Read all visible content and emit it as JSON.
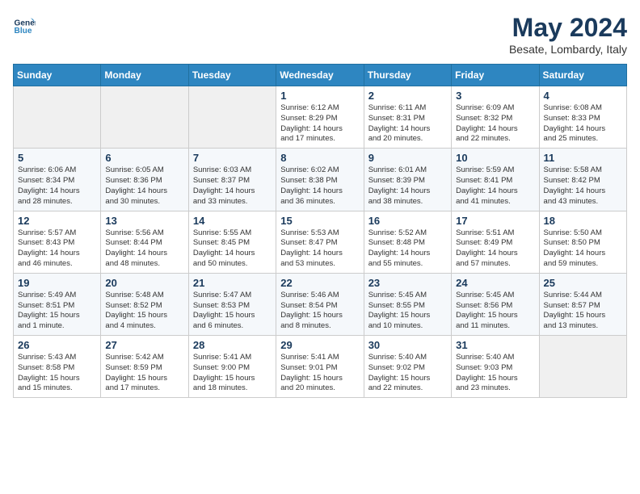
{
  "header": {
    "logo_line1": "General",
    "logo_line2": "Blue",
    "month": "May 2024",
    "location": "Besate, Lombardy, Italy"
  },
  "days_of_week": [
    "Sunday",
    "Monday",
    "Tuesday",
    "Wednesday",
    "Thursday",
    "Friday",
    "Saturday"
  ],
  "weeks": [
    [
      {
        "day": "",
        "info": ""
      },
      {
        "day": "",
        "info": ""
      },
      {
        "day": "",
        "info": ""
      },
      {
        "day": "1",
        "info": "Sunrise: 6:12 AM\nSunset: 8:29 PM\nDaylight: 14 hours\nand 17 minutes."
      },
      {
        "day": "2",
        "info": "Sunrise: 6:11 AM\nSunset: 8:31 PM\nDaylight: 14 hours\nand 20 minutes."
      },
      {
        "day": "3",
        "info": "Sunrise: 6:09 AM\nSunset: 8:32 PM\nDaylight: 14 hours\nand 22 minutes."
      },
      {
        "day": "4",
        "info": "Sunrise: 6:08 AM\nSunset: 8:33 PM\nDaylight: 14 hours\nand 25 minutes."
      }
    ],
    [
      {
        "day": "5",
        "info": "Sunrise: 6:06 AM\nSunset: 8:34 PM\nDaylight: 14 hours\nand 28 minutes."
      },
      {
        "day": "6",
        "info": "Sunrise: 6:05 AM\nSunset: 8:36 PM\nDaylight: 14 hours\nand 30 minutes."
      },
      {
        "day": "7",
        "info": "Sunrise: 6:03 AM\nSunset: 8:37 PM\nDaylight: 14 hours\nand 33 minutes."
      },
      {
        "day": "8",
        "info": "Sunrise: 6:02 AM\nSunset: 8:38 PM\nDaylight: 14 hours\nand 36 minutes."
      },
      {
        "day": "9",
        "info": "Sunrise: 6:01 AM\nSunset: 8:39 PM\nDaylight: 14 hours\nand 38 minutes."
      },
      {
        "day": "10",
        "info": "Sunrise: 5:59 AM\nSunset: 8:41 PM\nDaylight: 14 hours\nand 41 minutes."
      },
      {
        "day": "11",
        "info": "Sunrise: 5:58 AM\nSunset: 8:42 PM\nDaylight: 14 hours\nand 43 minutes."
      }
    ],
    [
      {
        "day": "12",
        "info": "Sunrise: 5:57 AM\nSunset: 8:43 PM\nDaylight: 14 hours\nand 46 minutes."
      },
      {
        "day": "13",
        "info": "Sunrise: 5:56 AM\nSunset: 8:44 PM\nDaylight: 14 hours\nand 48 minutes."
      },
      {
        "day": "14",
        "info": "Sunrise: 5:55 AM\nSunset: 8:45 PM\nDaylight: 14 hours\nand 50 minutes."
      },
      {
        "day": "15",
        "info": "Sunrise: 5:53 AM\nSunset: 8:47 PM\nDaylight: 14 hours\nand 53 minutes."
      },
      {
        "day": "16",
        "info": "Sunrise: 5:52 AM\nSunset: 8:48 PM\nDaylight: 14 hours\nand 55 minutes."
      },
      {
        "day": "17",
        "info": "Sunrise: 5:51 AM\nSunset: 8:49 PM\nDaylight: 14 hours\nand 57 minutes."
      },
      {
        "day": "18",
        "info": "Sunrise: 5:50 AM\nSunset: 8:50 PM\nDaylight: 14 hours\nand 59 minutes."
      }
    ],
    [
      {
        "day": "19",
        "info": "Sunrise: 5:49 AM\nSunset: 8:51 PM\nDaylight: 15 hours\nand 1 minute."
      },
      {
        "day": "20",
        "info": "Sunrise: 5:48 AM\nSunset: 8:52 PM\nDaylight: 15 hours\nand 4 minutes."
      },
      {
        "day": "21",
        "info": "Sunrise: 5:47 AM\nSunset: 8:53 PM\nDaylight: 15 hours\nand 6 minutes."
      },
      {
        "day": "22",
        "info": "Sunrise: 5:46 AM\nSunset: 8:54 PM\nDaylight: 15 hours\nand 8 minutes."
      },
      {
        "day": "23",
        "info": "Sunrise: 5:45 AM\nSunset: 8:55 PM\nDaylight: 15 hours\nand 10 minutes."
      },
      {
        "day": "24",
        "info": "Sunrise: 5:45 AM\nSunset: 8:56 PM\nDaylight: 15 hours\nand 11 minutes."
      },
      {
        "day": "25",
        "info": "Sunrise: 5:44 AM\nSunset: 8:57 PM\nDaylight: 15 hours\nand 13 minutes."
      }
    ],
    [
      {
        "day": "26",
        "info": "Sunrise: 5:43 AM\nSunset: 8:58 PM\nDaylight: 15 hours\nand 15 minutes."
      },
      {
        "day": "27",
        "info": "Sunrise: 5:42 AM\nSunset: 8:59 PM\nDaylight: 15 hours\nand 17 minutes."
      },
      {
        "day": "28",
        "info": "Sunrise: 5:41 AM\nSunset: 9:00 PM\nDaylight: 15 hours\nand 18 minutes."
      },
      {
        "day": "29",
        "info": "Sunrise: 5:41 AM\nSunset: 9:01 PM\nDaylight: 15 hours\nand 20 minutes."
      },
      {
        "day": "30",
        "info": "Sunrise: 5:40 AM\nSunset: 9:02 PM\nDaylight: 15 hours\nand 22 minutes."
      },
      {
        "day": "31",
        "info": "Sunrise: 5:40 AM\nSunset: 9:03 PM\nDaylight: 15 hours\nand 23 minutes."
      },
      {
        "day": "",
        "info": ""
      }
    ]
  ]
}
